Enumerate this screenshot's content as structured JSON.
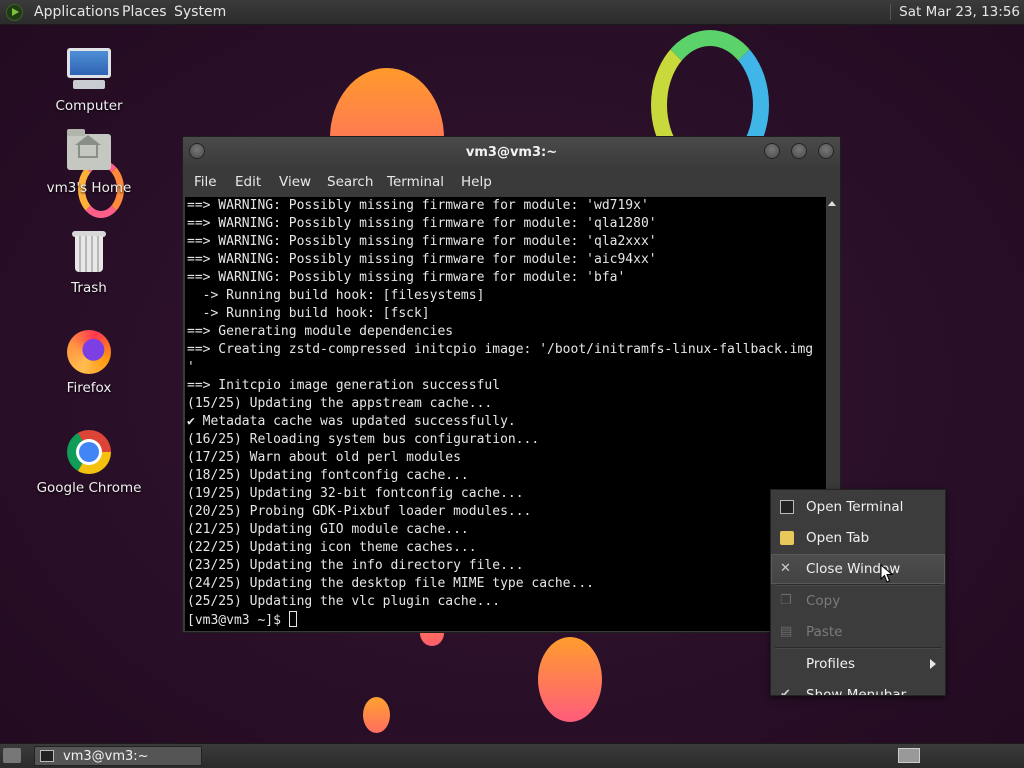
{
  "top_panel": {
    "menus": [
      "Applications",
      "Places",
      "System"
    ],
    "clock": "Sat Mar 23, 13:56"
  },
  "desktop_icons": [
    {
      "label": "Computer",
      "icon": "computer-icon"
    },
    {
      "label": "vm3's Home",
      "icon": "home-folder-icon"
    },
    {
      "label": "Trash",
      "icon": "trash-icon"
    },
    {
      "label": "Firefox",
      "icon": "firefox-icon"
    },
    {
      "label": "Google Chrome",
      "icon": "chrome-icon"
    }
  ],
  "terminal": {
    "title": "vm3@vm3:~",
    "menu": [
      "File",
      "Edit",
      "View",
      "Search",
      "Terminal",
      "Help"
    ],
    "lines": [
      "==> WARNING: Possibly missing firmware for module: 'wd719x'",
      "==> WARNING: Possibly missing firmware for module: 'qla1280'",
      "==> WARNING: Possibly missing firmware for module: 'qla2xxx'",
      "==> WARNING: Possibly missing firmware for module: 'aic94xx'",
      "==> WARNING: Possibly missing firmware for module: 'bfa'",
      "  -> Running build hook: [filesystems]",
      "  -> Running build hook: [fsck]",
      "==> Generating module dependencies",
      "==> Creating zstd-compressed initcpio image: '/boot/initramfs-linux-fallback.img",
      "'",
      "==> Initcpio image generation successful",
      "(15/25) Updating the appstream cache...",
      "✔ Metadata cache was updated successfully.",
      "(16/25) Reloading system bus configuration...",
      "(17/25) Warn about old perl modules",
      "(18/25) Updating fontconfig cache...",
      "(19/25) Updating 32-bit fontconfig cache...",
      "(20/25) Probing GDK-Pixbuf loader modules...",
      "(21/25) Updating GIO module cache...",
      "(22/25) Updating icon theme caches...",
      "(23/25) Updating the info directory file...",
      "(24/25) Updating the desktop file MIME type cache...",
      "(25/25) Updating the vlc plugin cache..."
    ],
    "prompt": "[vm3@vm3 ~]$ "
  },
  "context_menu": {
    "items": [
      {
        "label": "Open Terminal",
        "icon": "terminal-icon",
        "enabled": true
      },
      {
        "label": "Open Tab",
        "icon": "tab-icon",
        "enabled": true
      },
      {
        "label": "Close Window",
        "icon": "close-icon",
        "enabled": true,
        "hover": true
      },
      {
        "label": "Copy",
        "icon": "copy-icon",
        "enabled": false
      },
      {
        "label": "Paste",
        "icon": "paste-icon",
        "enabled": false
      },
      {
        "label": "Profiles",
        "icon": "",
        "enabled": true,
        "submenu": true
      },
      {
        "label": "Show Menubar",
        "icon": "check-icon",
        "enabled": true
      }
    ]
  },
  "bottom_panel": {
    "task_label": "vm3@vm3:~"
  },
  "colors": {
    "wallpaper": "#2a0f28",
    "panel": "#333333",
    "terminal_bg": "#000000",
    "menu_bg": "#3c3c3c"
  }
}
